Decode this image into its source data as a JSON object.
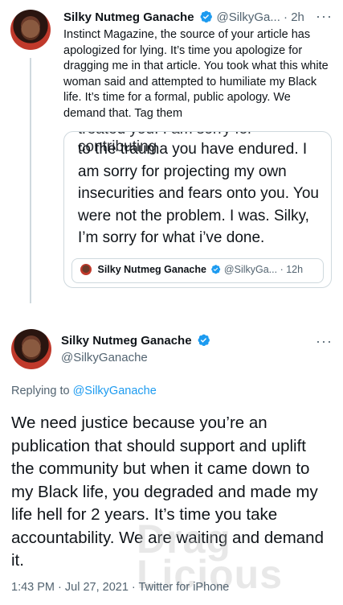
{
  "tweet1": {
    "display_name": "Silky Nutmeg Ganache",
    "handle_time": "@SilkyGa... · 2h",
    "more": "···",
    "text": "Instinct Magazine, the source of your article has apologized for lying. It’s time you apologize for dragging me in that article. You took what this white woman said and attempted to humiliate my Black life. It’s time for a formal, public apology. We demand that. Tag them",
    "quote": {
      "cut_line": "treated you. I am sorry for contributing",
      "text": "to the trauma you have endured. I am sorry for projecting my own insecurities and fears onto you. You were not the problem. I was. Silky, I’m sorry for what i’ve done.",
      "inner_name": "Silky Nutmeg Ganache",
      "inner_handle_time": "@SilkyGa... · 12h"
    }
  },
  "tweet2": {
    "display_name": "Silky Nutmeg Ganache",
    "handle": "@SilkyGanache",
    "more": "···",
    "replying_prefix": "Replying to ",
    "replying_to": "@SilkyGanache",
    "text": "We need justice because you’re an publication that should support and uplift the community but when it came down to my Black life, you degraded and made my life hell for 2 years. It’s time you take accountability. We are waiting and demand it.",
    "meta": "1:43 PM · Jul 27, 2021 · Twitter for iPhone"
  },
  "watermark": [
    "Drag",
    "Licious"
  ],
  "colors": {
    "accent": "#1d9bf0",
    "muted": "#536471",
    "border": "#cfd9de"
  },
  "icons": {
    "verified": "verified-badge-icon",
    "more": "more-options-icon"
  }
}
